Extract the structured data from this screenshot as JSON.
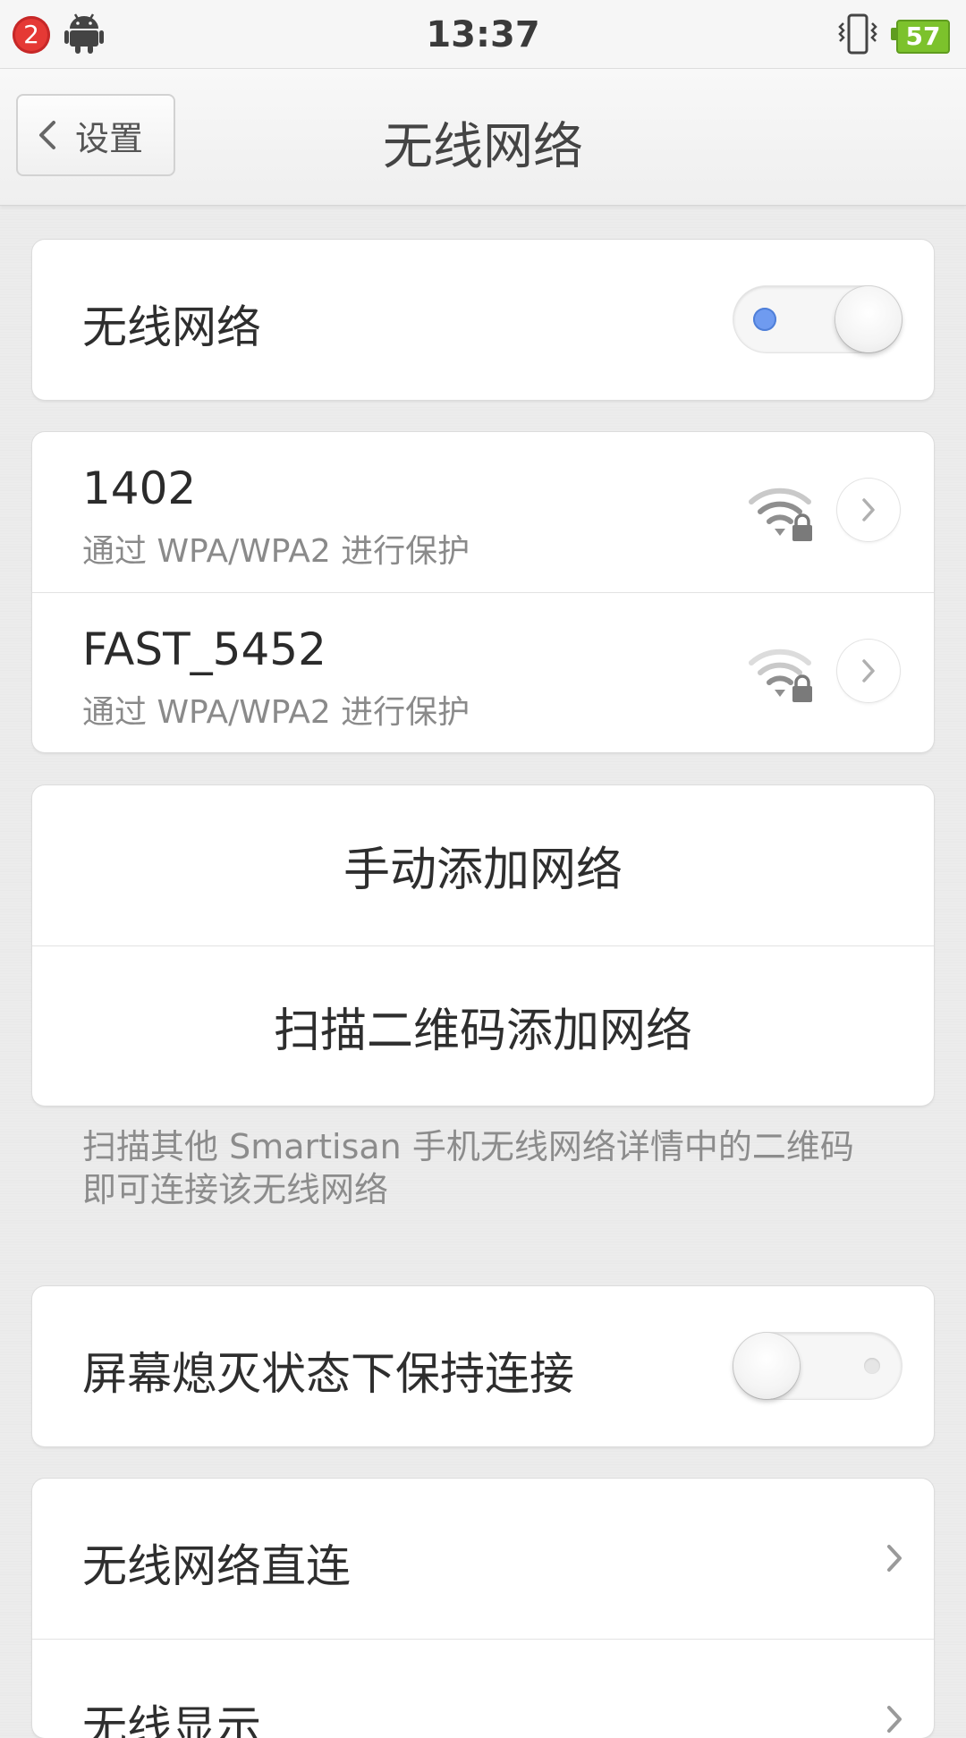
{
  "status_bar": {
    "notification_count": "2",
    "time": "13:37",
    "battery_level": "57",
    "icons": [
      "android-icon",
      "vibrate-icon",
      "battery-icon"
    ],
    "battery_color": "#7cc22c",
    "badge_color": "#e53935"
  },
  "nav": {
    "back_label": "设置",
    "title": "无线网络"
  },
  "wifi_toggle": {
    "label": "无线网络",
    "state": "on",
    "accent_color": "#6f9bf0"
  },
  "networks": [
    {
      "name": "1402",
      "security": "通过 WPA/WPA2 进行保护",
      "signal_icon": "wifi-lock-icon"
    },
    {
      "name": "FAST_5452",
      "security": "通过 WPA/WPA2 进行保护",
      "signal_icon": "wifi-lock-icon"
    }
  ],
  "add_actions": {
    "manual": "手动添加网络",
    "qr": "扫描二维码添加网络"
  },
  "footnote": "扫描其他 Smartisan 手机无线网络详情中的二维码即可连接该无线网络",
  "keep_connected": {
    "label": "屏幕熄灭状态下保持连接",
    "state": "off"
  },
  "more": {
    "direct": "无线网络直连",
    "display": "无线显示"
  }
}
